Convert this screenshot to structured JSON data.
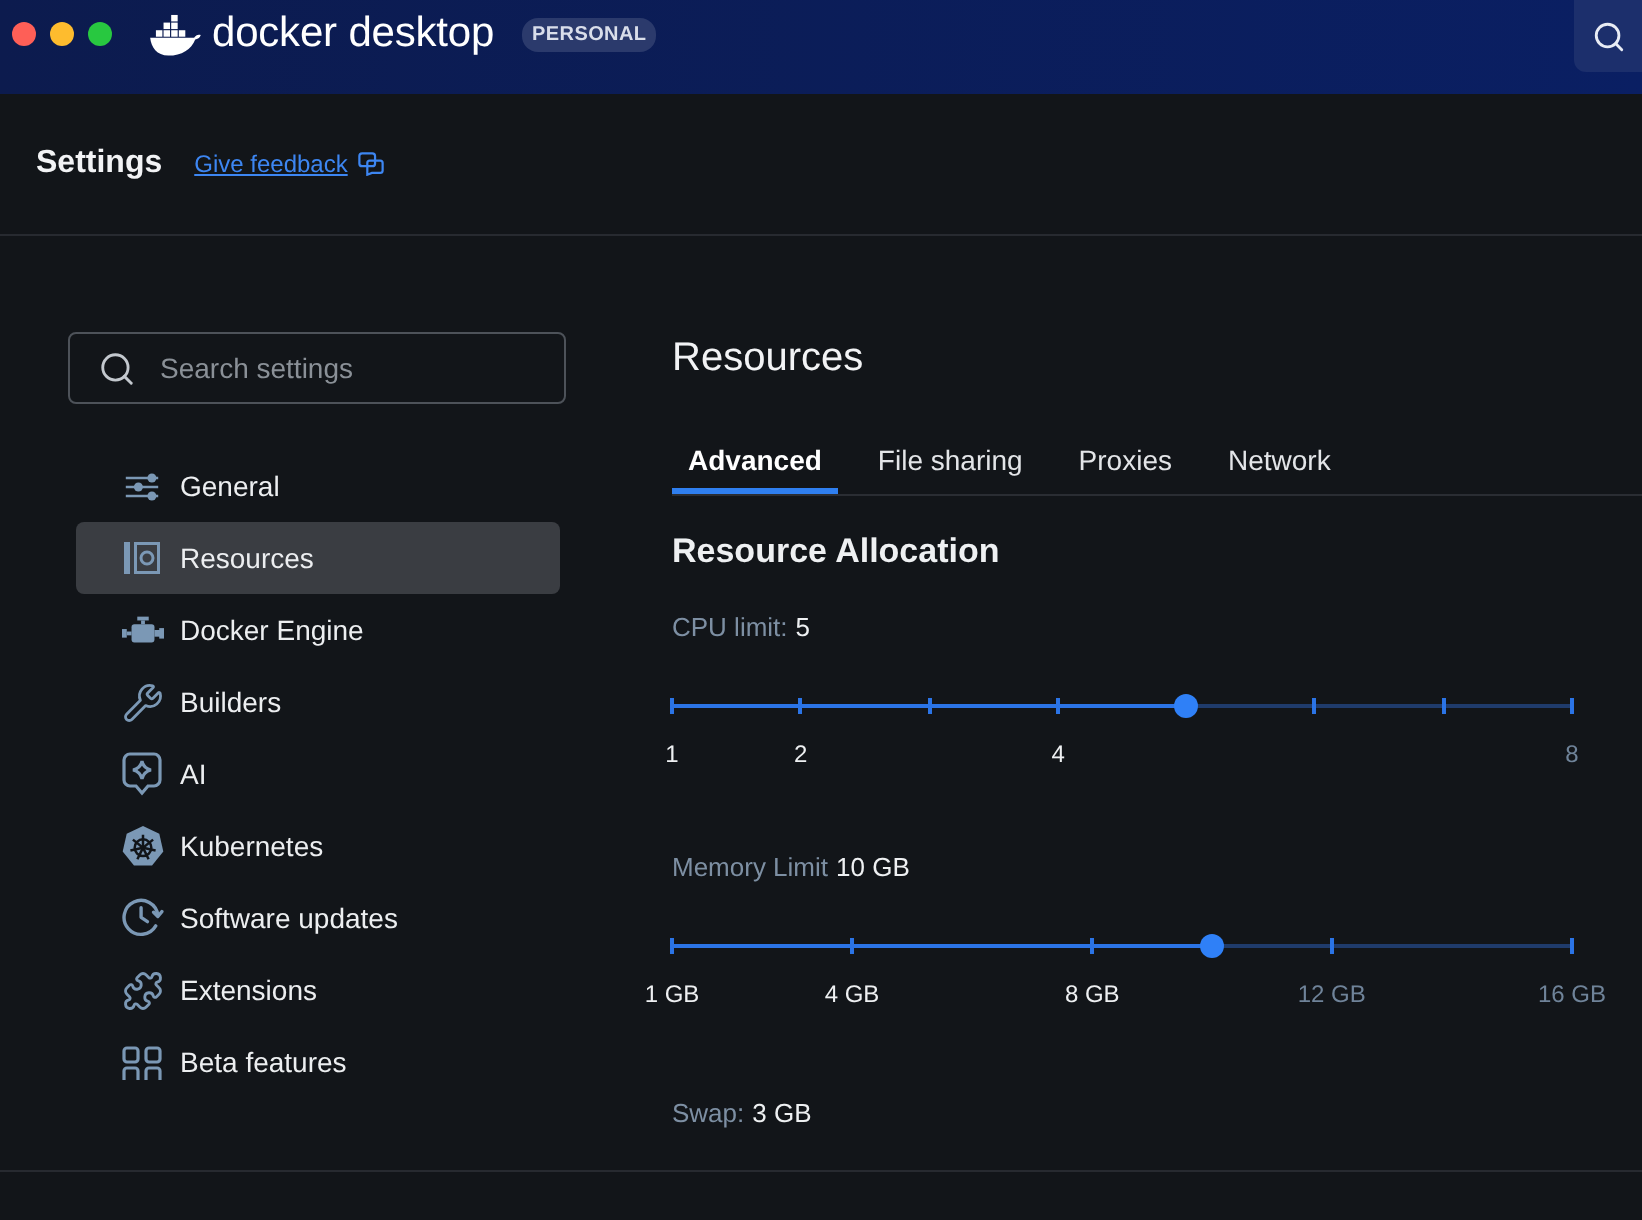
{
  "top_bar": {
    "logo": {
      "primary": "docker",
      "secondary": "desktop"
    },
    "badge": "PERSONAL"
  },
  "header": {
    "title": "Settings",
    "feedback_link": "Give feedback"
  },
  "sidebar": {
    "search": {
      "placeholder": "Search settings"
    },
    "items": [
      {
        "label": "General",
        "selected": false
      },
      {
        "label": "Resources",
        "selected": true
      },
      {
        "label": "Docker Engine",
        "selected": false
      },
      {
        "label": "Builders",
        "selected": false
      },
      {
        "label": "AI",
        "selected": false
      },
      {
        "label": "Kubernetes",
        "selected": false
      },
      {
        "label": "Software updates",
        "selected": false
      },
      {
        "label": "Extensions",
        "selected": false
      },
      {
        "label": "Beta features",
        "selected": false
      }
    ]
  },
  "content": {
    "title": "Resources",
    "tabs": [
      {
        "label": "Advanced",
        "selected": true
      },
      {
        "label": "File sharing",
        "selected": false
      },
      {
        "label": "Proxies",
        "selected": false
      },
      {
        "label": "Network",
        "selected": false
      }
    ],
    "section_title": "Resource Allocation",
    "sliders": [
      {
        "label": "CPU limit:",
        "value": "5",
        "level": 0.571,
        "ticks": [
          {
            "level": 0,
            "label": "1"
          },
          {
            "level": 0.143,
            "label": "2"
          },
          {
            "level": 0.286
          },
          {
            "level": 0.429,
            "label": "4"
          },
          {
            "level": 0.714
          },
          {
            "level": 0.857
          },
          {
            "level": 1,
            "label": "8"
          }
        ]
      },
      {
        "label": "Memory Limit",
        "value": "10 GB",
        "level": 0.6,
        "ticks": [
          {
            "level": 0,
            "label": "1 GB"
          },
          {
            "level": 0.2,
            "label": "4 GB"
          },
          {
            "level": 0.467,
            "label": "8 GB"
          },
          {
            "level": 0.733,
            "label": "12 GB"
          },
          {
            "level": 1,
            "label": "16 GB"
          }
        ]
      }
    ],
    "swap": {
      "label": "Swap:",
      "value": "3 GB"
    }
  }
}
